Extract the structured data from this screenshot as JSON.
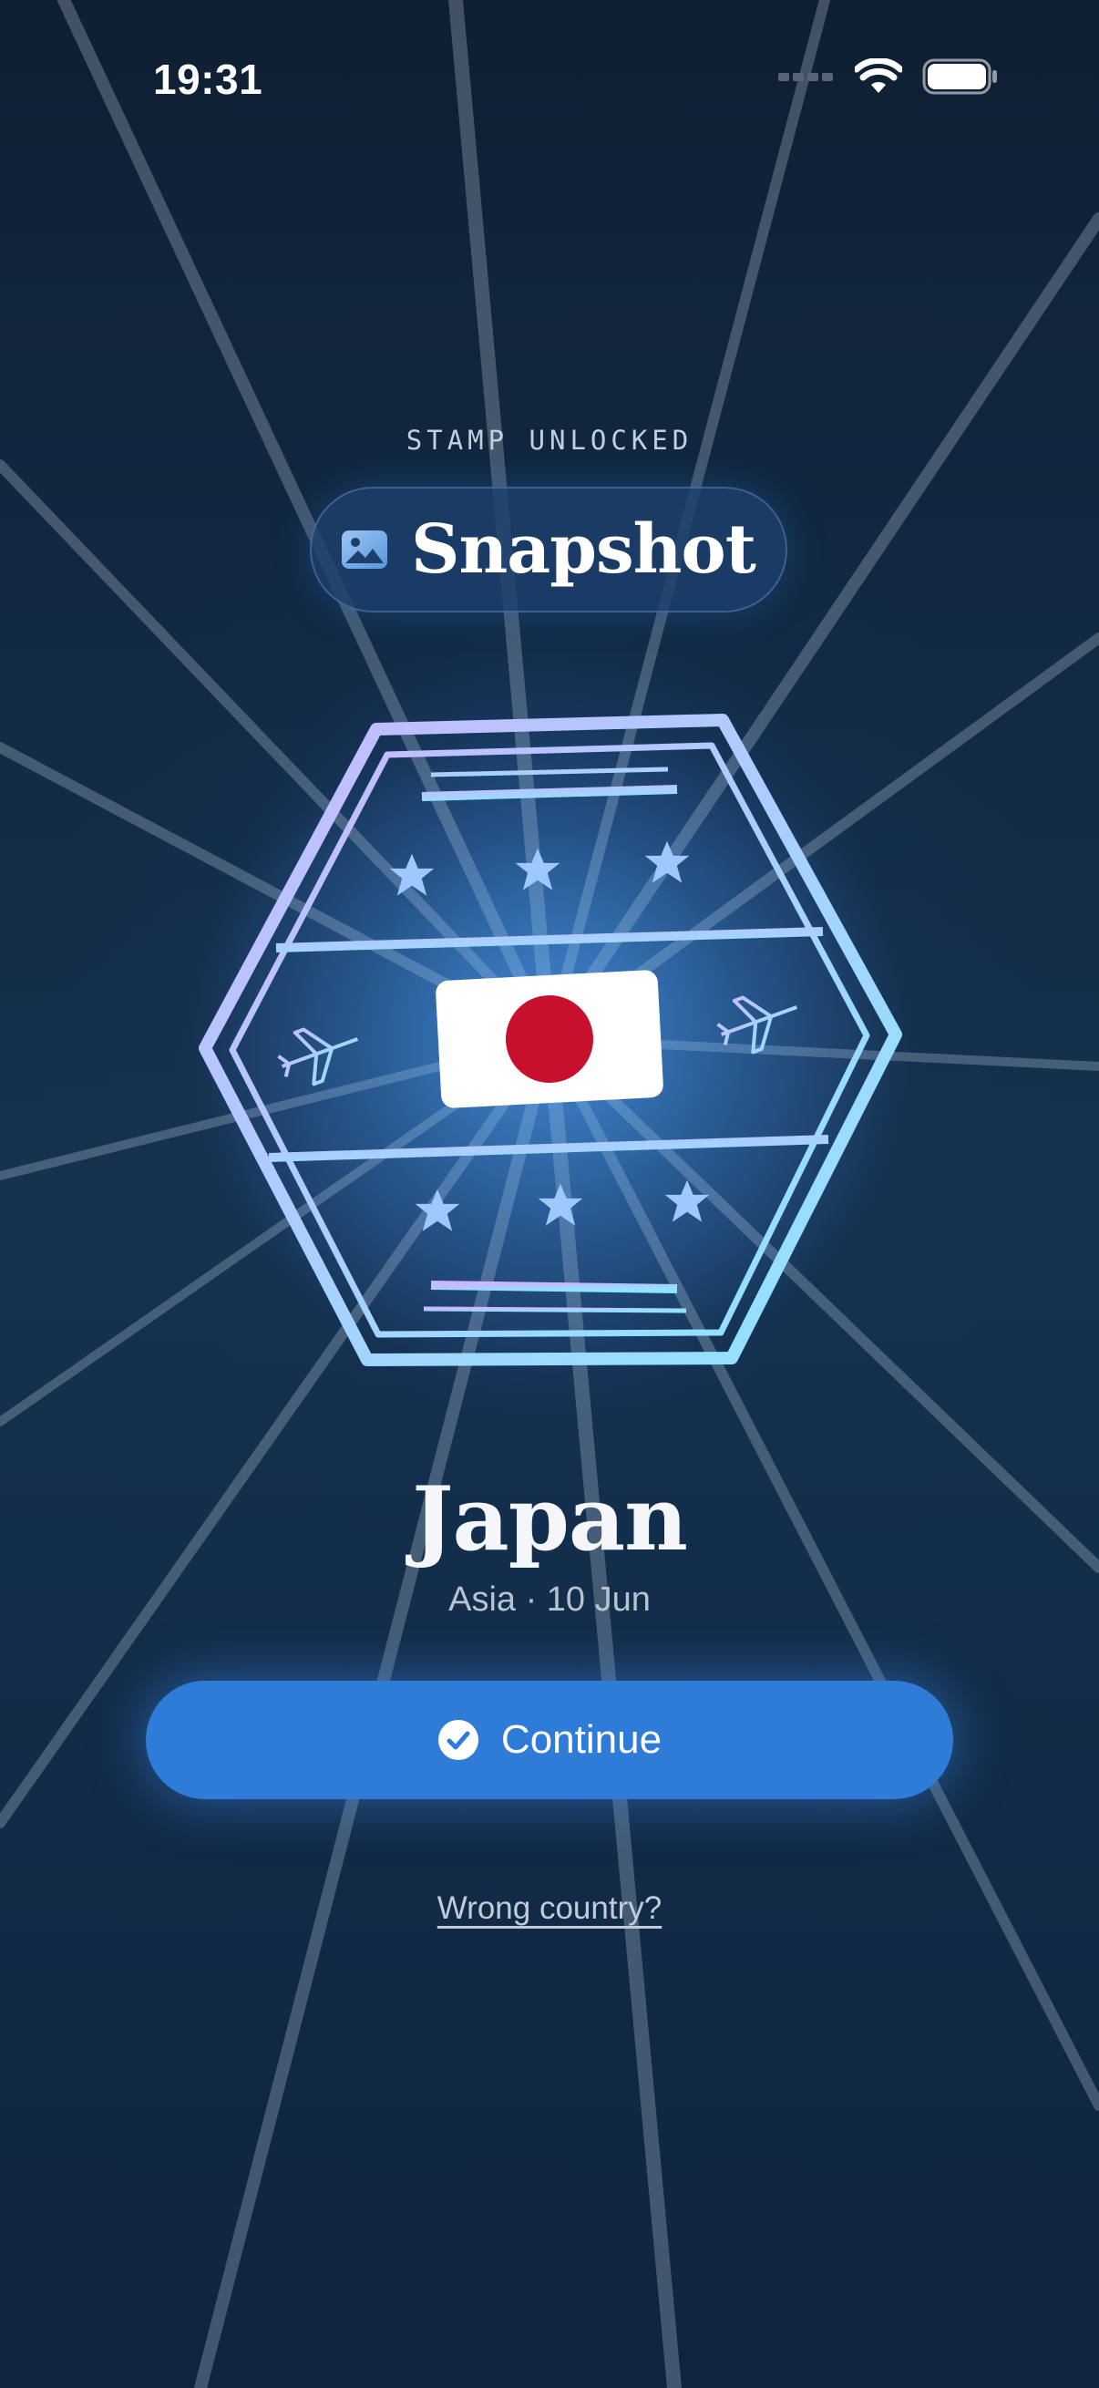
{
  "status_bar": {
    "time": "19:31"
  },
  "header": {
    "eyebrow": "STAMP UNLOCKED",
    "title": "Snapshot",
    "title_icon": "photo-icon"
  },
  "stamp": {
    "shape": "hexagon",
    "flag": "Japan",
    "decorations": [
      "star-icon",
      "airplane-icon"
    ]
  },
  "country": {
    "name": "Japan",
    "subtitle": "Asia · 10 Jun"
  },
  "actions": {
    "continue_label": "Continue",
    "continue_icon": "check-circle-icon",
    "wrong_country_label": "Wrong country?"
  },
  "colors": {
    "accent": "#2f7bd8",
    "flag_red": "#c8102e",
    "background": "#0f1f33"
  }
}
